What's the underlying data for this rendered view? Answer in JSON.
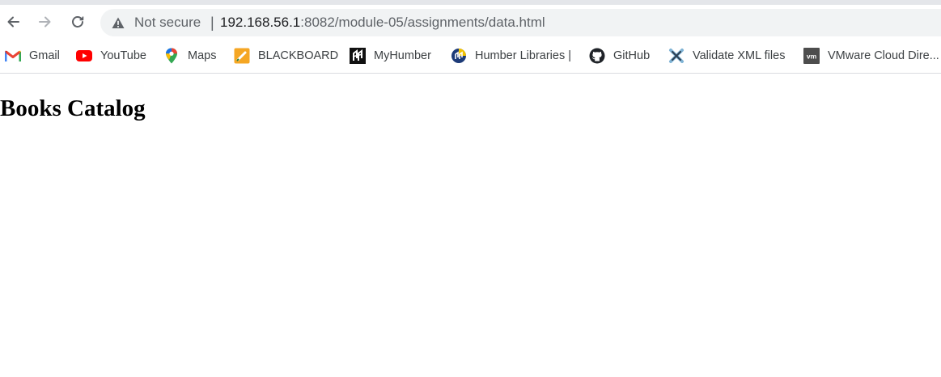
{
  "browser": {
    "security_label": "Not secure",
    "separator": "|",
    "url_host": "192.168.56.1",
    "url_rest": ":8082/module-05/assignments/data.html"
  },
  "bookmarks": [
    {
      "label": "Gmail",
      "icon": "gmail-icon"
    },
    {
      "label": "YouTube",
      "icon": "youtube-icon"
    },
    {
      "label": "Maps",
      "icon": "maps-icon"
    },
    {
      "label": "BLACKBOARD",
      "icon": "blackboard-icon"
    },
    {
      "label": "MyHumber",
      "icon": "myhumber-icon"
    },
    {
      "label": "Humber Libraries |",
      "icon": "humber-libraries-icon"
    },
    {
      "label": "GitHub",
      "icon": "github-icon"
    },
    {
      "label": "Validate XML files",
      "icon": "xml-validator-icon"
    },
    {
      "label": "VMware Cloud Dire...",
      "icon": "vmware-icon"
    }
  ],
  "page": {
    "title": "Books Catalog"
  },
  "colors": {
    "toolbar_bg": "#ffffff",
    "omnibox_bg": "#f1f3f4",
    "tab_strip": "#e4e6ea",
    "text_secondary": "#5f6368",
    "youtube_red": "#ff0000"
  }
}
